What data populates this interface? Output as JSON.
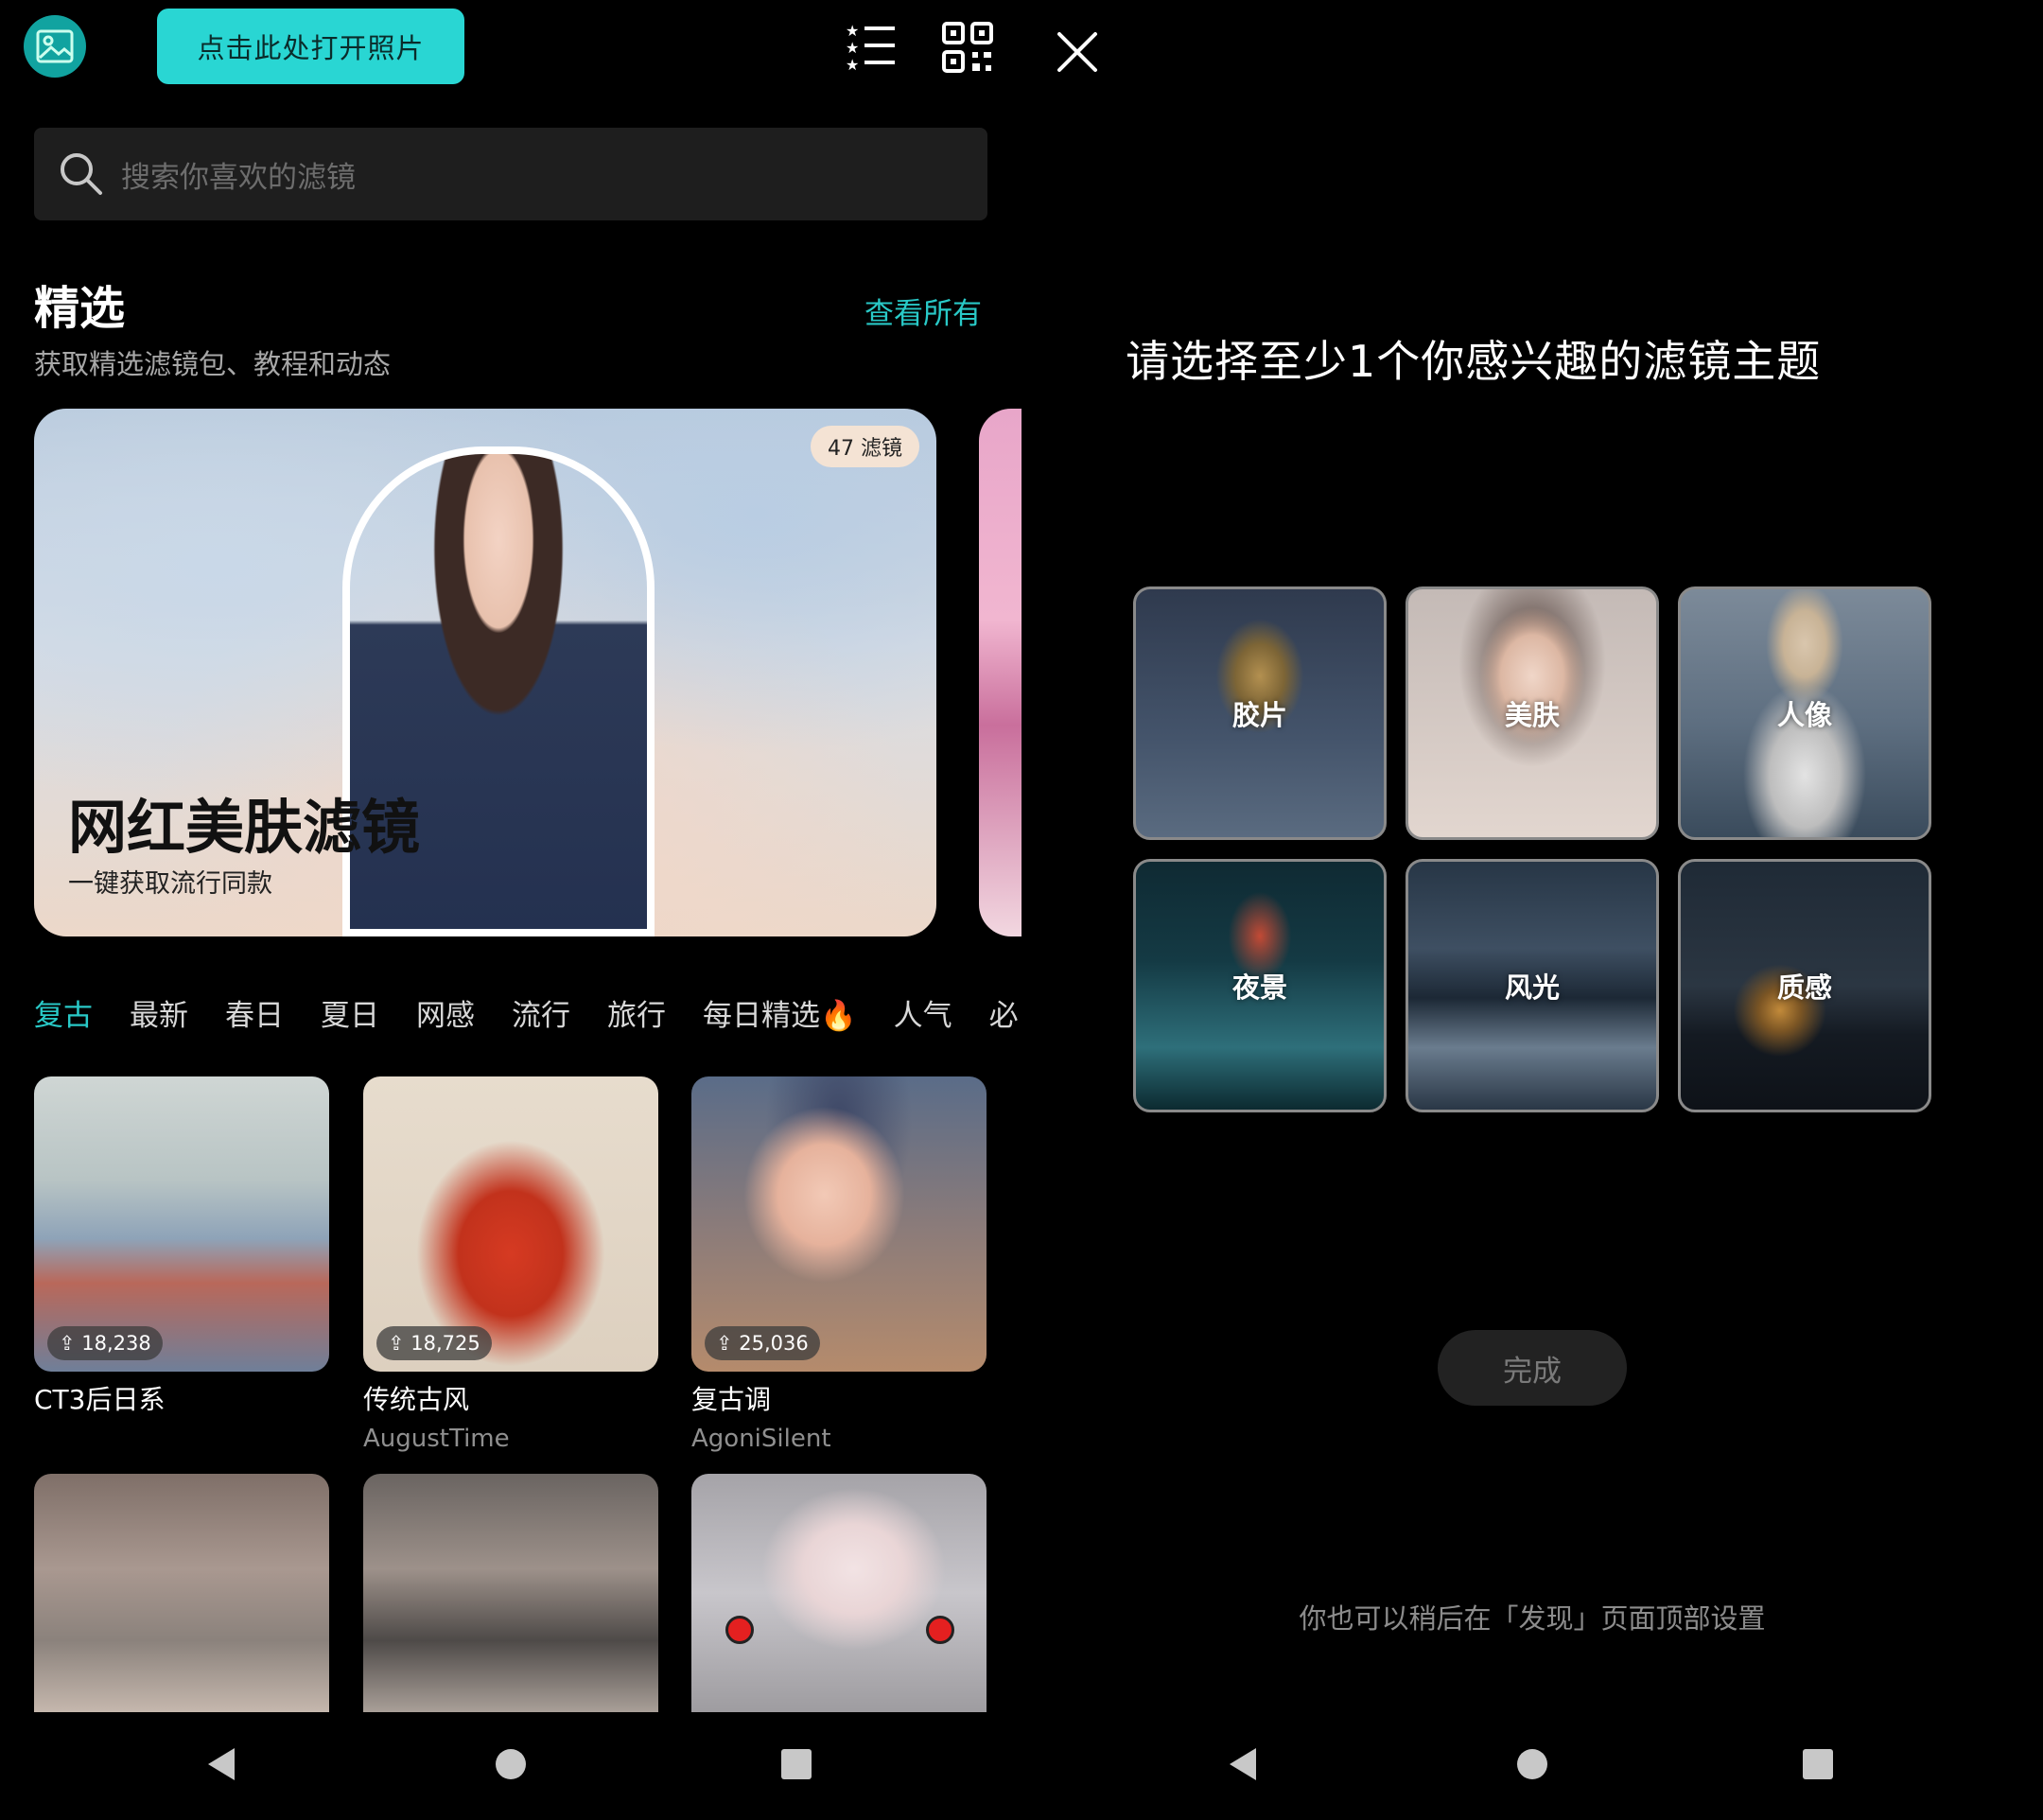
{
  "left": {
    "open_photo_button": "点击此处打开照片",
    "search": {
      "placeholder": "搜索你喜欢的滤镜"
    },
    "featured": {
      "title": "精选",
      "subtitle": "获取精选滤镜包、教程和动态",
      "see_all": "查看所有"
    },
    "hero": {
      "badge": "47 滤镜",
      "title": "网红美肤滤镜",
      "subtitle": "一键获取流行同款"
    },
    "tabs": [
      "复古",
      "最新",
      "春日",
      "夏日",
      "网感",
      "流行",
      "旅行",
      "每日精选🔥",
      "人气",
      "必"
    ],
    "cards": [
      {
        "name": "CT3后日系",
        "author": "",
        "count": "18,238"
      },
      {
        "name": "传统古风",
        "author": "AugustTime",
        "count": "18,725"
      },
      {
        "name": "复古调",
        "author": "AgoniSilent",
        "count": "25,036"
      }
    ]
  },
  "right": {
    "prompt": "请选择至少1个你感兴趣的滤镜主题",
    "topics": [
      "胶片",
      "美肤",
      "人像",
      "夜景",
      "风光",
      "质感"
    ],
    "done_button": "完成",
    "hint": "你也可以稍后在「发现」页面顶部设置"
  },
  "colors": {
    "accent": "#29d6d3",
    "background": "#000000",
    "search_bg": "#1e1e1e"
  },
  "icons": [
    "app-logo-icon",
    "starred-list-icon",
    "qr-code-icon",
    "search-icon",
    "close-icon",
    "back-icon",
    "home-icon",
    "recents-icon"
  ]
}
